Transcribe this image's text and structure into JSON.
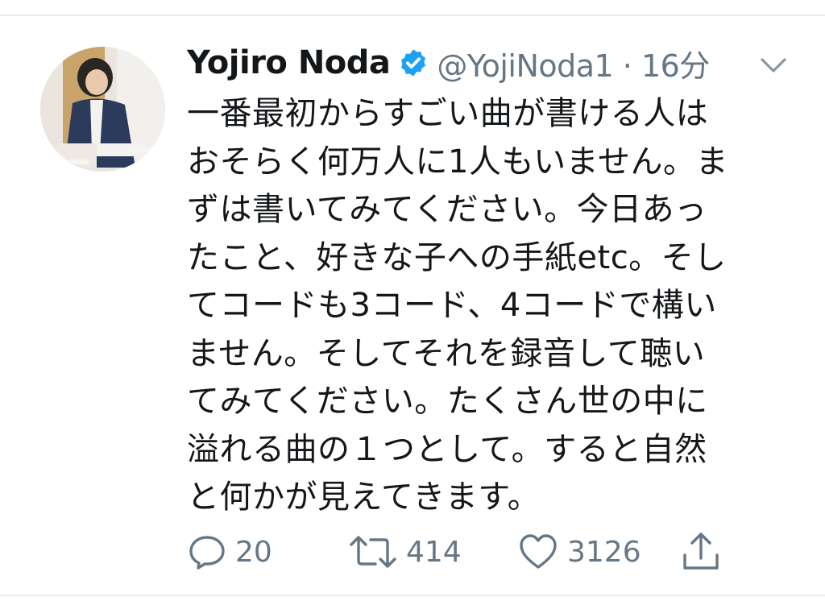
{
  "tweet": {
    "display_name": "Yojiro Noda",
    "handle_time": "@YojiNoda1 · 16分",
    "verified_icon": "verified-badge-icon",
    "avatar_alt": "profile photo",
    "text": "一番最初からすごい曲が書ける人は\nおそらく何万人に1人もいません。ま\nずは書いてみてください。今日あっ\nたこと、好きな子への手紙etc。そし\nてコードも3コード、4コードで構い\nません。そしてそれを録音して聴い\nてみてください。たくさん世の中に\n溢れる曲の１つとして。すると自然\nと何かが見えてきます。"
  },
  "actions": {
    "reply_count": "20",
    "retweet_count": "414",
    "like_count": "3126"
  },
  "colors": {
    "text": "#14171a",
    "secondary": "#657786",
    "verified": "#1da1f2",
    "divider": "#e6ecf0"
  }
}
